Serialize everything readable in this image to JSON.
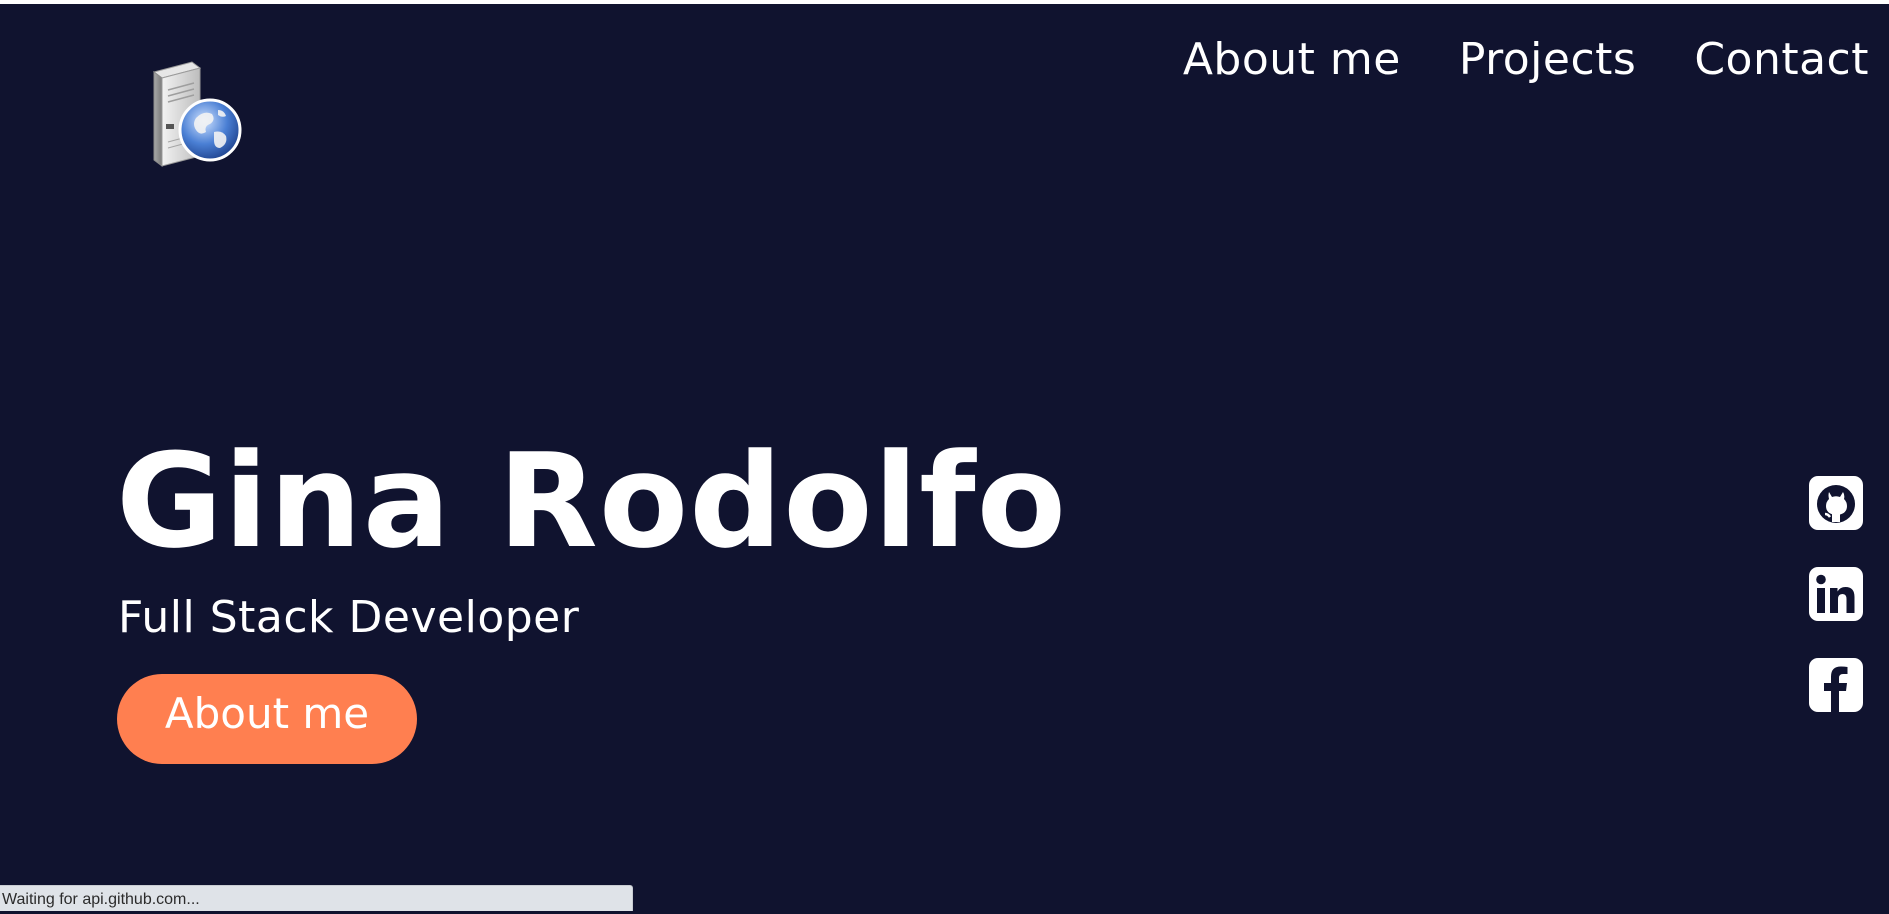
{
  "header": {
    "logo_icon": "server-globe-icon",
    "nav": [
      {
        "label": "About me"
      },
      {
        "label": "Projects"
      },
      {
        "label": "Contact"
      }
    ]
  },
  "hero": {
    "name": "Gina Rodolfo",
    "role": "Full Stack Developer",
    "cta_label": "About me"
  },
  "social": [
    {
      "icon": "github-icon"
    },
    {
      "icon": "linkedin-icon"
    },
    {
      "icon": "facebook-icon"
    }
  ],
  "browser_status": {
    "text": "Waiting for api.github.com..."
  },
  "colors": {
    "background": "#10132f",
    "accent": "#ff7f50",
    "text": "#ffffff"
  }
}
